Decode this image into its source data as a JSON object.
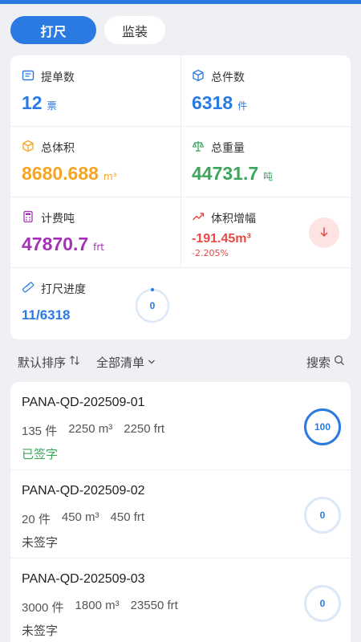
{
  "tabs": [
    {
      "label": "打尺",
      "active": true
    },
    {
      "label": "监装",
      "active": false
    }
  ],
  "stats": {
    "bill_count": {
      "label": "提单数",
      "value": "12",
      "unit": "票",
      "icon": "document-icon"
    },
    "piece_count": {
      "label": "总件数",
      "value": "6318",
      "unit": "件",
      "icon": "box-icon"
    },
    "volume": {
      "label": "总体积",
      "value": "8680.688",
      "unit": "m³",
      "icon": "cube-icon"
    },
    "weight": {
      "label": "总重量",
      "value": "44731.7",
      "unit": "吨",
      "icon": "scale-icon"
    },
    "billing_ton": {
      "label": "计费吨",
      "value": "47870.7",
      "unit": "frt",
      "icon": "calculator-icon"
    },
    "volume_change": {
      "label": "体积增幅",
      "value": "-191.45m³",
      "percent": "-2.205%",
      "icon": "trend-up-icon",
      "button_icon": "arrow-down-icon"
    },
    "progress": {
      "label": "打尺进度",
      "value": "11/6318",
      "ring_value": "0",
      "icon": "ruler-icon"
    }
  },
  "toolbar": {
    "sort_label": "默认排序",
    "filter_label": "全部清单",
    "search_label": "搜索"
  },
  "items": [
    {
      "title": "PANA-QD-202509-01",
      "pieces": "135 件",
      "volume": "2250 m³",
      "frt": "2250 frt",
      "status": "已签字",
      "signed": true,
      "progress": "100",
      "progress_fraction": 1.0
    },
    {
      "title": "PANA-QD-202509-02",
      "pieces": "20 件",
      "volume": "450 m³",
      "frt": "450 frt",
      "status": "未签字",
      "signed": false,
      "progress": "0",
      "progress_fraction": 0.0
    },
    {
      "title": "PANA-QD-202509-03",
      "pieces": "3000 件",
      "volume": "1800 m³",
      "frt": "23550 frt",
      "status": "未签字",
      "signed": false,
      "progress": "0",
      "progress_fraction": 0.0
    }
  ],
  "colors": {
    "accent": "#2a7ae2",
    "orange": "#f4a522",
    "green": "#3ca55c",
    "purple": "#a432b5",
    "red": "#e64a45"
  }
}
